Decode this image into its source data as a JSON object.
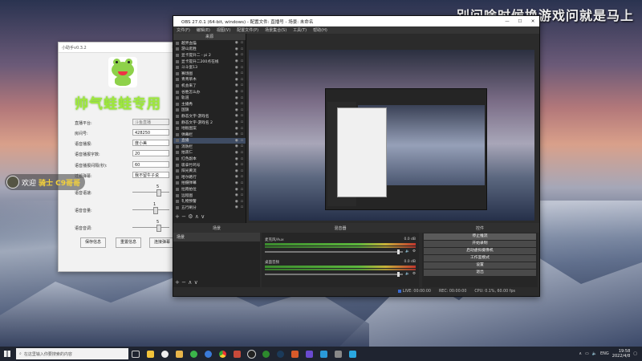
{
  "overlay_title": "别问啥时候换游戏问就是马上",
  "helper": {
    "title": "小助手v0.3.2",
    "banner": "帅气蛙蛙专用",
    "fields": [
      {
        "label": "直播平台:",
        "value": "斗鱼直播"
      },
      {
        "label": "房间号:",
        "value": "428250"
      },
      {
        "label": "语音播报:",
        "value": "度小美"
      },
      {
        "label": "语音播报字数:",
        "value": "20"
      },
      {
        "label": "语音播报间隔(秒):",
        "value": "60"
      },
      {
        "label": "过滤弹幕:",
        "value": "我不留牛子说"
      }
    ],
    "sliders": [
      {
        "label": "语音语速:",
        "value": "5"
      },
      {
        "label": "语音音量:",
        "value": "1"
      },
      {
        "label": "语音音调:",
        "value": "5"
      }
    ],
    "buttons": [
      "保存信息",
      "重置信息",
      "连接弹幕"
    ]
  },
  "chat": {
    "welcome": "欢迎",
    "name": "骑士 C9哥哥"
  },
  "obs": {
    "title": "OBS 27.0.1 (64-bit, windows) - 配置文件: 直播号 - 场景: 未命名",
    "menu": [
      "文件(F)",
      "编辑(E)",
      "视图(V)",
      "配置文件(P)",
      "场景集合(S)",
      "工具(T)",
      "帮助(H)"
    ],
    "sources_header": "来源",
    "sources": [
      "越界血猫",
      "游山逛胜",
      "显卡提升二 - pi 2",
      "显卡提升二200点在线",
      "斗斗蛋13",
      "赛场图",
      "青青草木",
      "机会来了",
      "谷胜怎么办",
      "轨道",
      "主播秀",
      "国旗",
      "静态文字-游戏名",
      "静态文字-游戏名 2",
      "地板图案",
      "弹幕栏",
      "直播",
      "消防栏",
      "拍黑仁",
      "红色副本",
      "吸拿竹鸡号",
      "阳光黄流",
      "哈尔路行",
      "拍摄弹幕",
      "拉跑拍位",
      "远程图",
      "礼物预警",
      "五行刷分"
    ],
    "selected_source_index": 16,
    "panels": [
      "场景",
      "混音器",
      "控件"
    ],
    "scene": "场景",
    "mixer": [
      {
        "name": "麦克风/Aux",
        "db": "0.0 dB"
      },
      {
        "name": "桌面音频",
        "db": "0.0 dB"
      }
    ],
    "controls": [
      "停止推流",
      "开始录制",
      "启动虚拟摄像机",
      "工作室模式",
      "设置",
      "退出"
    ],
    "status": {
      "live": "LIVE: 00:00:00",
      "rec": "REC: 00:00:00",
      "cpu": "CPU: 0.1%, 60.00 fps"
    }
  },
  "taskbar": {
    "search_placeholder": "在这里输入你要搜索的内容",
    "lang": "ENG",
    "time": "19:58",
    "date": "2022/4/8"
  }
}
